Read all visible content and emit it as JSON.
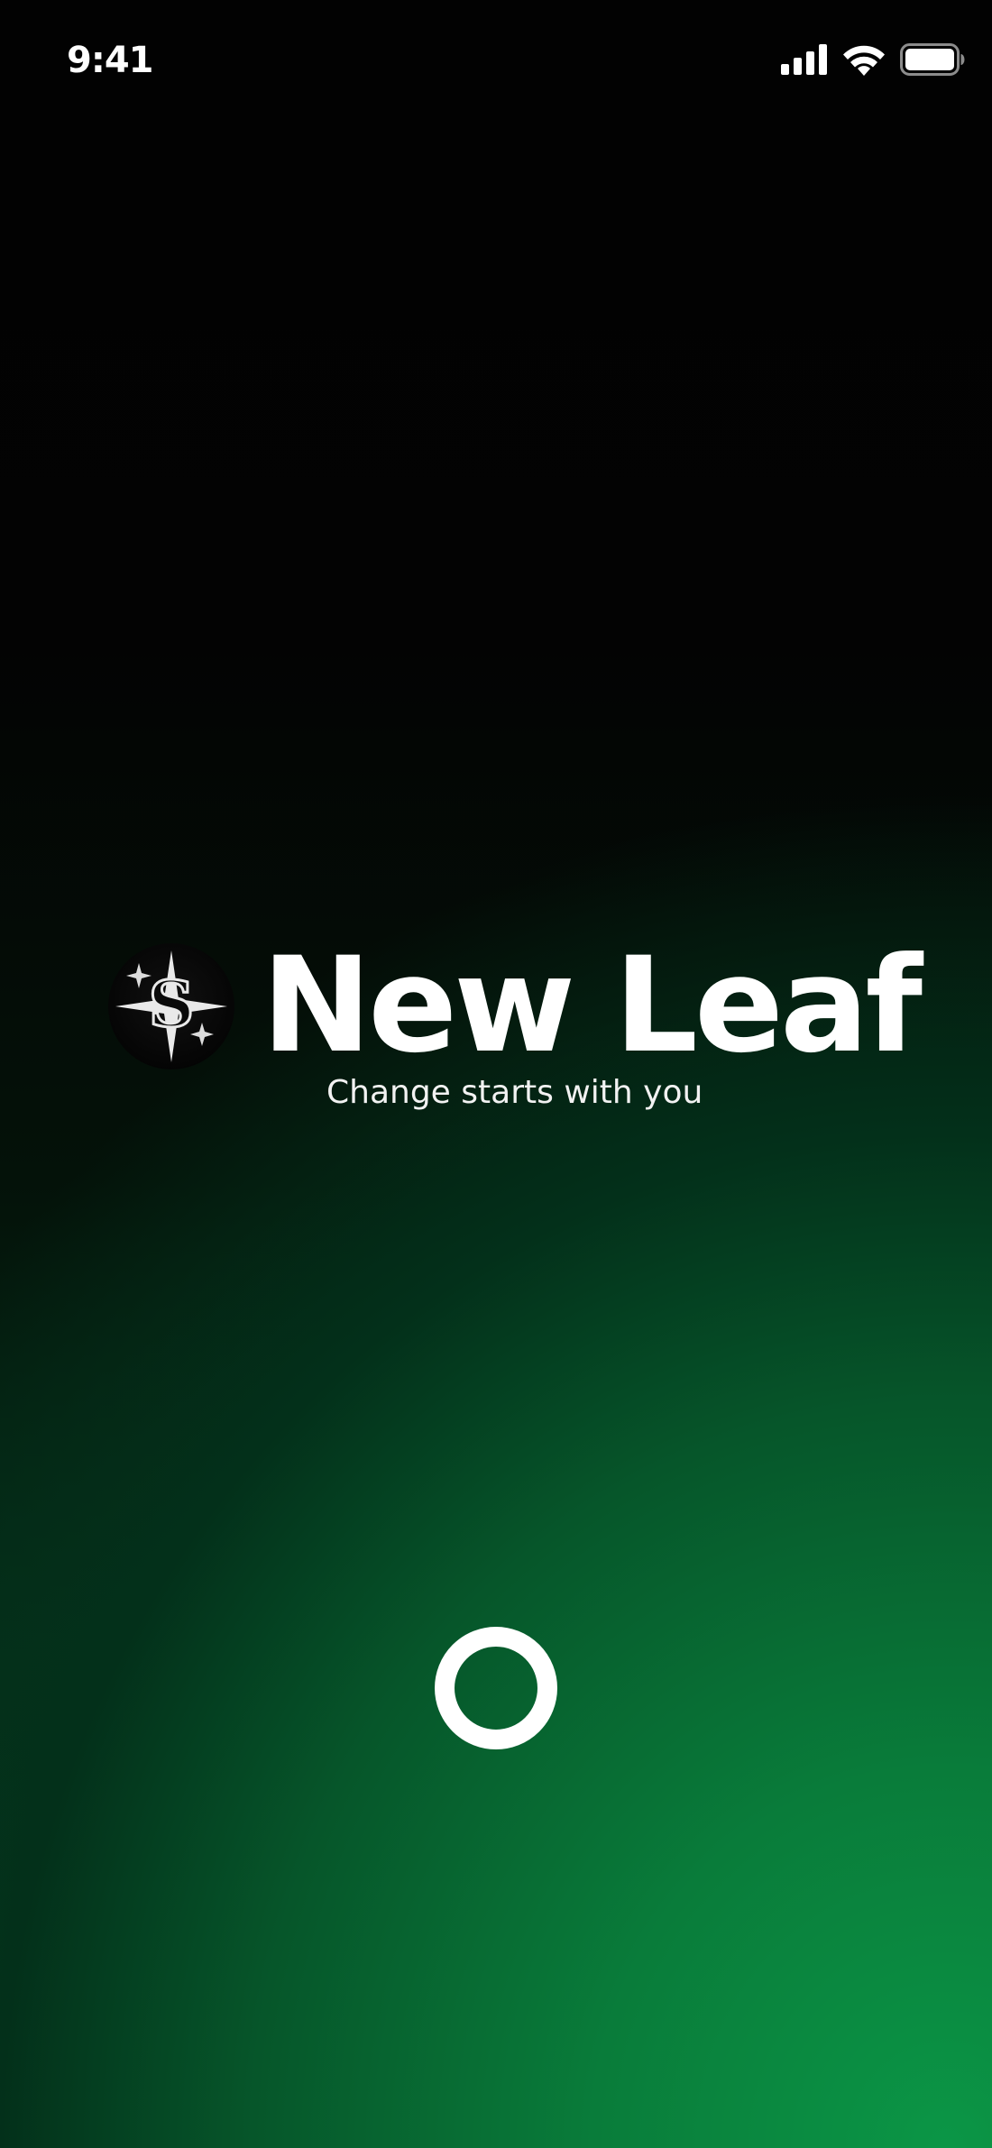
{
  "status_bar": {
    "time": "9:41",
    "icons": [
      "cellular-signal-icon",
      "wifi-icon",
      "battery-icon"
    ]
  },
  "brand": {
    "logo_icon": "dollar-compass-star-icon",
    "title": "New Leaf",
    "tagline": "Change starts with you"
  },
  "loader": {
    "icon": "loading-ring-icon"
  },
  "colors": {
    "background_top": "#020202",
    "background_accent": "#0b9646",
    "text": "#ffffff"
  }
}
